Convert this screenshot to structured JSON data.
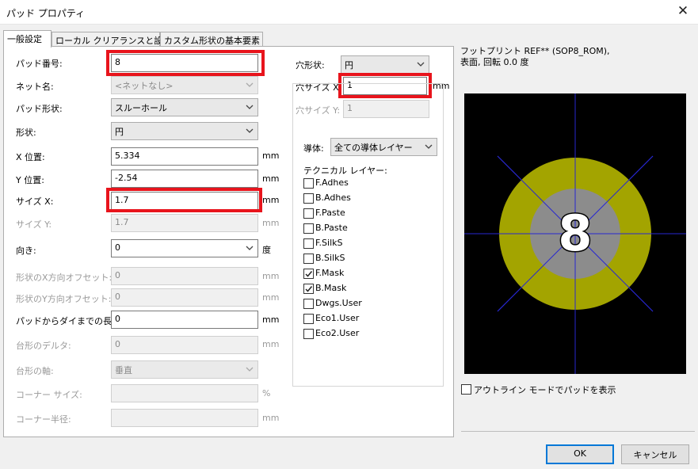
{
  "window": {
    "title": "パッド プロパティ",
    "close_glyph": "✕"
  },
  "tabs": [
    "一般設定",
    "ローカル クリアランスと設定",
    "カスタム形状の基本要素"
  ],
  "form": {
    "pad_number": {
      "label": "パッド番号:",
      "value": "8"
    },
    "net_name": {
      "label": "ネット名:",
      "value": "<ネットなし>"
    },
    "pad_type": {
      "label": "パッド形状:",
      "value": "スルーホール"
    },
    "shape": {
      "label": "形状:",
      "value": "円"
    },
    "x_pos": {
      "label": "X 位置:",
      "value": "5.334",
      "unit": "mm"
    },
    "y_pos": {
      "label": "Y 位置:",
      "value": "-2.54",
      "unit": "mm"
    },
    "size_x": {
      "label": "サイズ X:",
      "value": "1.7",
      "unit": "mm"
    },
    "size_y": {
      "label": "サイズ Y:",
      "value": "1.7",
      "unit": "mm"
    },
    "orientation": {
      "label": "向き:",
      "value": "0",
      "unit": "度"
    },
    "offset_x": {
      "label": "形状のX方向オフセット:",
      "value": "0",
      "unit": "mm"
    },
    "offset_y": {
      "label": "形状のY方向オフセット:",
      "value": "0",
      "unit": "mm"
    },
    "pad_to_die": {
      "label": "パッドからダイまでの長さ:",
      "value": "0",
      "unit": "mm"
    },
    "trap_delta": {
      "label": "台形のデルタ:",
      "value": "0",
      "unit": "mm"
    },
    "trap_axis": {
      "label": "台形の軸:",
      "value": "垂直"
    },
    "corner_size": {
      "label": "コーナー サイズ:",
      "value": "",
      "unit": "%"
    },
    "corner_radius": {
      "label": "コーナー半径:",
      "value": "",
      "unit": "mm"
    }
  },
  "drill": {
    "shape": {
      "label": "穴形状:",
      "value": "円"
    },
    "size_x": {
      "label": "穴サイズ X:",
      "value": "1",
      "unit": "mm"
    },
    "size_y": {
      "label": "穴サイズ Y:",
      "value": "1"
    }
  },
  "layers": {
    "copper_label": "導体:",
    "copper_value": "全ての導体レイヤー",
    "technical_label": "テクニカル レイヤー:",
    "items": [
      {
        "name": "F.Adhes",
        "checked": false
      },
      {
        "name": "B.Adhes",
        "checked": false
      },
      {
        "name": "F.Paste",
        "checked": false
      },
      {
        "name": "B.Paste",
        "checked": false
      },
      {
        "name": "F.SilkS",
        "checked": false
      },
      {
        "name": "B.SilkS",
        "checked": false
      },
      {
        "name": "F.Mask",
        "checked": true
      },
      {
        "name": "B.Mask",
        "checked": true
      },
      {
        "name": "Dwgs.User",
        "checked": false
      },
      {
        "name": "Eco1.User",
        "checked": false
      },
      {
        "name": "Eco2.User",
        "checked": false
      }
    ]
  },
  "preview": {
    "info_line1": "フットプリント REF** (SOP8_ROM),",
    "info_line2": "表面, 回転 0.0 度",
    "pad_label": "8",
    "outline_label": "アウトライン モードでパッドを表示",
    "outline_checked": false
  },
  "buttons": {
    "ok": "OK",
    "cancel": "キャンセル"
  },
  "colors": {
    "highlight": "#e8141c",
    "pad_ring": "#a3a400",
    "pad_hole": "#8c8c8c",
    "crosshair": "#2828d0"
  }
}
